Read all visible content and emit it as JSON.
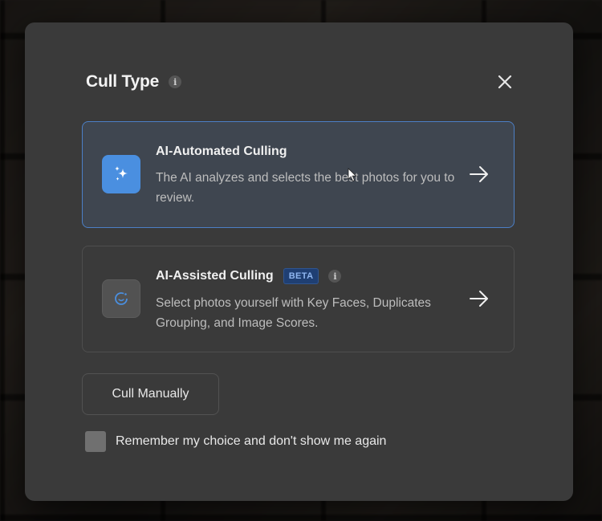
{
  "dialog": {
    "title": "Cull Type",
    "info_glyph": "i",
    "close_icon": "close-icon"
  },
  "options": [
    {
      "title": "AI-Automated Culling",
      "description": "The AI analyzes and selects the best photos for you to review.",
      "icon": "sparkle-icon",
      "selected": true,
      "accent": "#4a8fe0"
    },
    {
      "title": "AI-Assisted Culling",
      "badge": "BETA",
      "info_glyph": "i",
      "description": "Select photos yourself with Key Faces, Duplicates Grouping, and Image Scores.",
      "icon": "assisted-cull-icon",
      "selected": false
    }
  ],
  "manual_button": {
    "label": "Cull Manually"
  },
  "remember": {
    "label": "Remember my choice and don't show me again",
    "checked": false
  },
  "colors": {
    "modal_bg": "#3a3a3a",
    "selected_border": "#4c7fc6",
    "badge_bg": "#1f3f73"
  }
}
